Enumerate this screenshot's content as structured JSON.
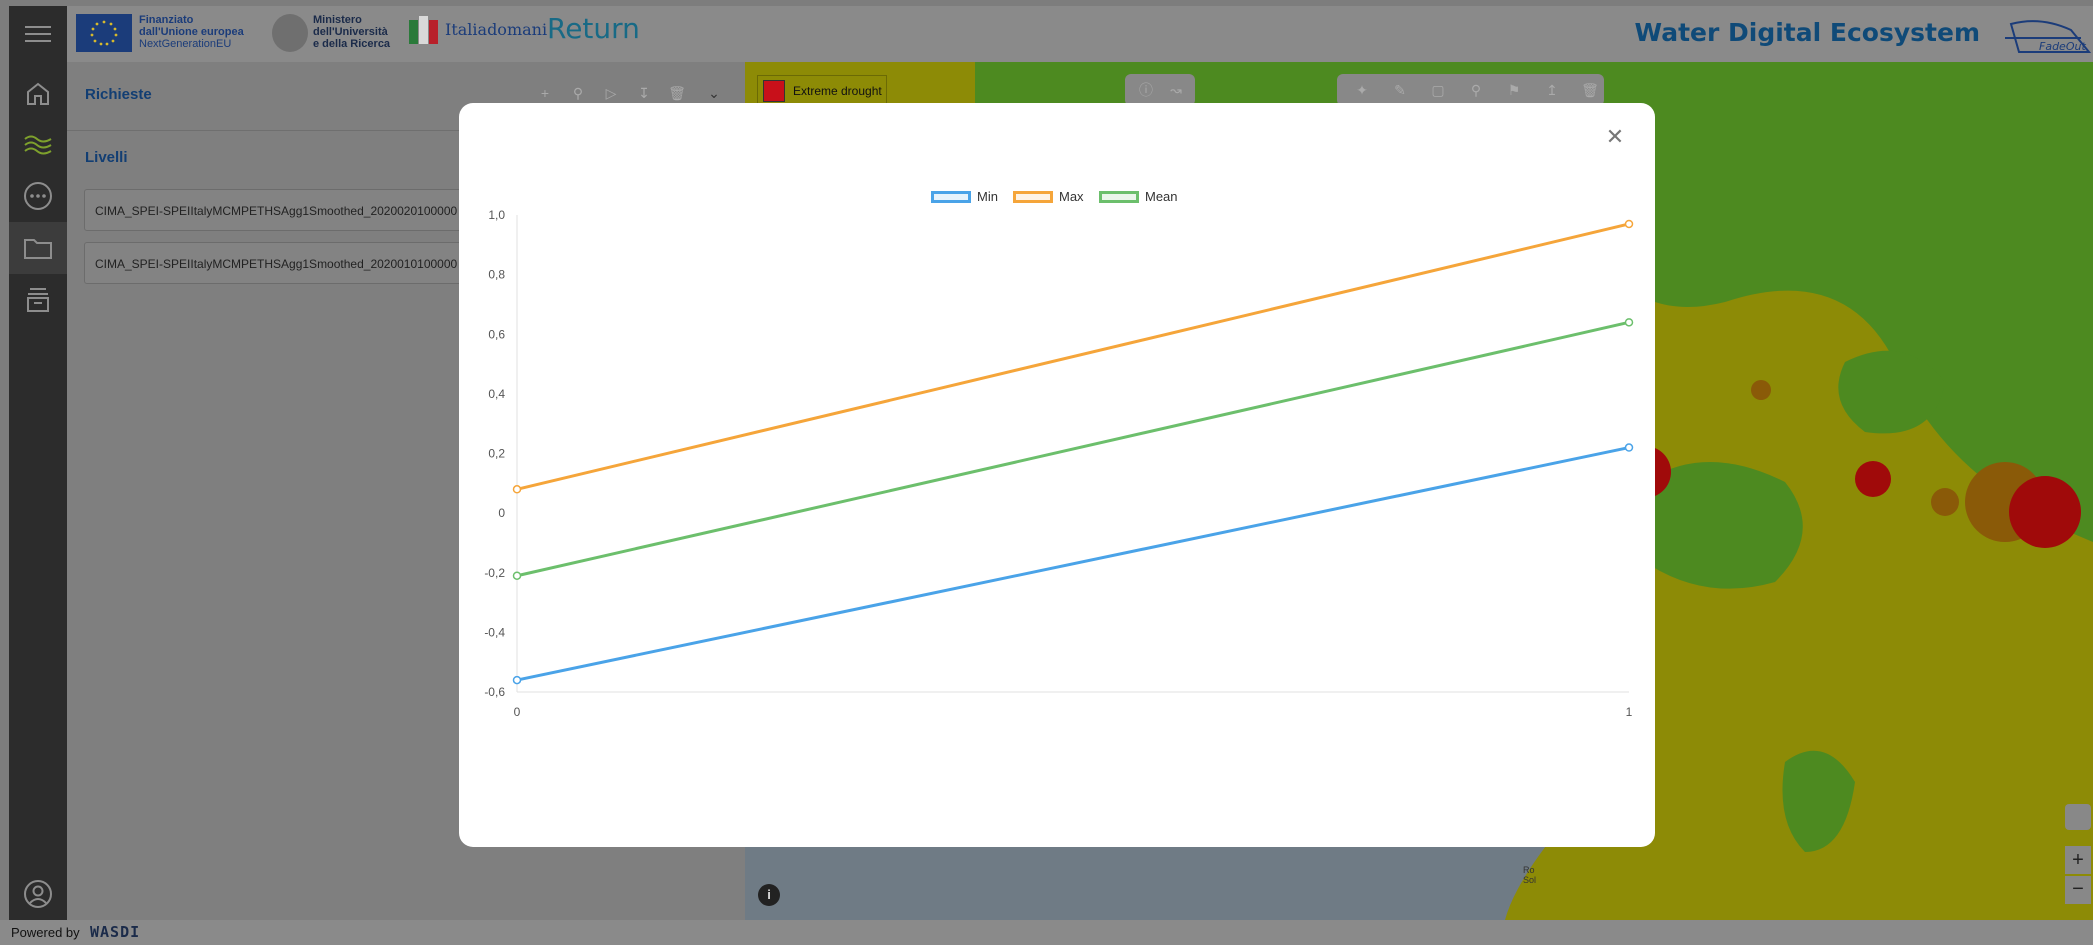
{
  "header": {
    "sponsor_1": [
      "Finanziato",
      "dall'Unione europea",
      "NextGenerationEU"
    ],
    "sponsor_2": [
      "Ministero",
      "dell'Università",
      "e della Ricerca"
    ],
    "sponsor_3": "Italiadomani",
    "sponsor_4": "Return",
    "title": "Water Digital Ecosystem",
    "partner_logo": "FadeOut"
  },
  "sidebar": {
    "items": [
      {
        "icon": "menu-icon"
      },
      {
        "icon": "home-icon"
      },
      {
        "icon": "water-wave-icon"
      },
      {
        "icon": "more-icon"
      },
      {
        "icon": "folder-icon",
        "active": true
      },
      {
        "icon": "archive-icon"
      },
      {
        "icon": "user-icon"
      }
    ]
  },
  "panel": {
    "requests_title": "Richieste",
    "levels_title": "Livelli",
    "layers": [
      "CIMA_SPEI-SPEIItalyMCMPETHSAgg1Smoothed_2020020100000",
      "CIMA_SPEI-SPEIItalyMCMPETHSAgg1Smoothed_2020010100000"
    ]
  },
  "map": {
    "legend_label": "Extreme drought",
    "legend_color": "#c8101a",
    "place_label": [
      "Ro",
      "Sol"
    ]
  },
  "footer": {
    "powered_by": "Powered by",
    "brand": "WASDI"
  },
  "colors": {
    "min": "#4aa3e8",
    "max": "#f5a53a",
    "mean": "#6cbf6c"
  },
  "chart_data": {
    "type": "line",
    "x": [
      0,
      1
    ],
    "series": [
      {
        "name": "Min",
        "values": [
          -0.56,
          0.22
        ]
      },
      {
        "name": "Max",
        "values": [
          0.08,
          0.97
        ]
      },
      {
        "name": "Mean",
        "values": [
          -0.21,
          0.64
        ]
      }
    ],
    "ylim": [
      -0.6,
      1.0
    ],
    "xlim": [
      0,
      1
    ],
    "y_ticks": [
      "-0,6",
      "-0,4",
      "-0,2",
      "0",
      "0,2",
      "0,4",
      "0,6",
      "0,8",
      "1,0"
    ],
    "x_ticks": [
      "0",
      "1"
    ],
    "legend": "top-center",
    "grid": false
  }
}
